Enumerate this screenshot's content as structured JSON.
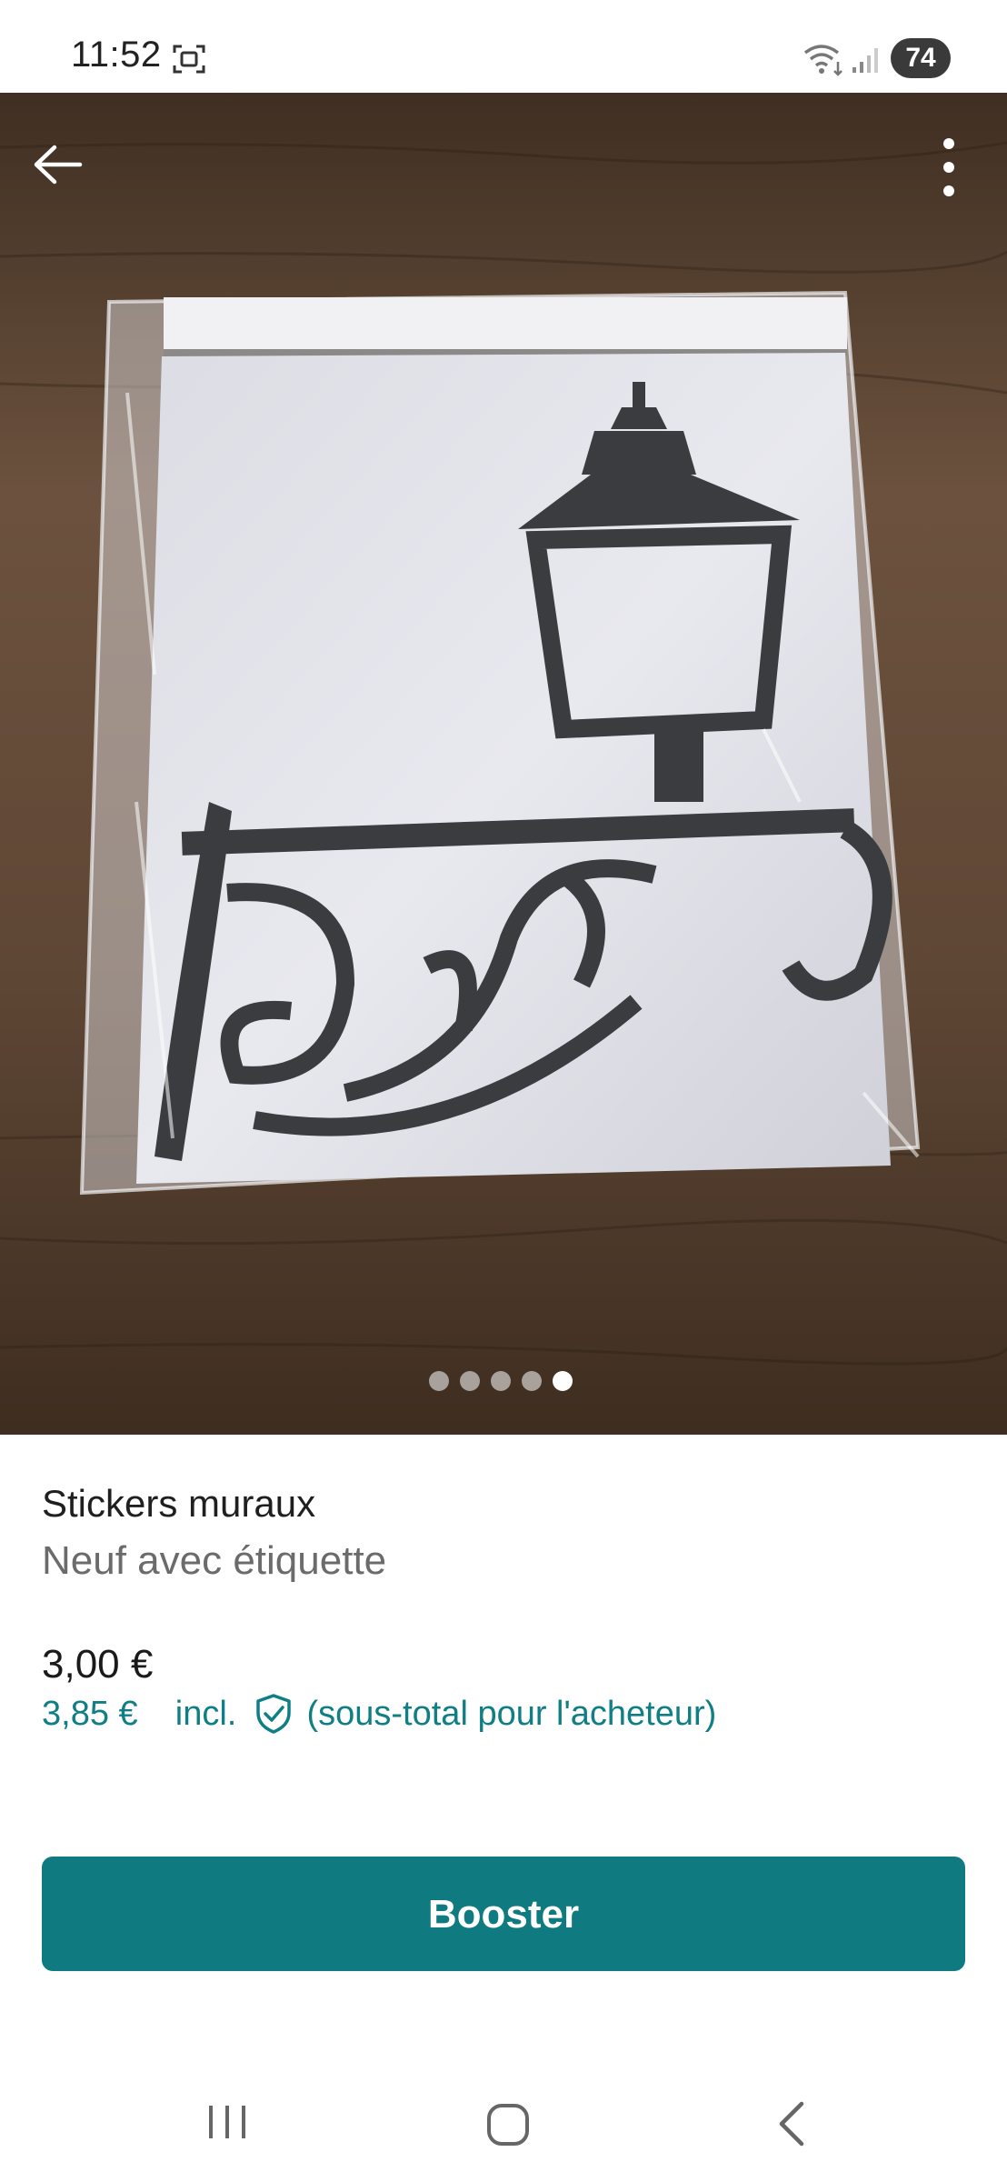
{
  "status_bar": {
    "time": "11:52",
    "battery": "74",
    "icons": [
      "screenshot-icon",
      "wifi-icon",
      "signal-icon"
    ]
  },
  "hero": {
    "icons": [
      "back-arrow-icon",
      "more-vertical-icon"
    ],
    "carousel": {
      "total": 5,
      "active_index": 4
    }
  },
  "item": {
    "title": "Stickers muraux",
    "condition": "Neuf avec étiquette",
    "price": "3,00 €",
    "buyer_price": "3,85 €",
    "incl_label": "incl.",
    "buyer_note": "(sous-total pour l'acheteur)"
  },
  "actions": {
    "boost_label": "Booster"
  },
  "colors": {
    "accent": "#0f7a80",
    "buyer_price_text": "#0f7e85"
  },
  "nav_bar": {
    "icons": [
      "recent-apps-icon",
      "home-icon",
      "back-icon"
    ]
  }
}
